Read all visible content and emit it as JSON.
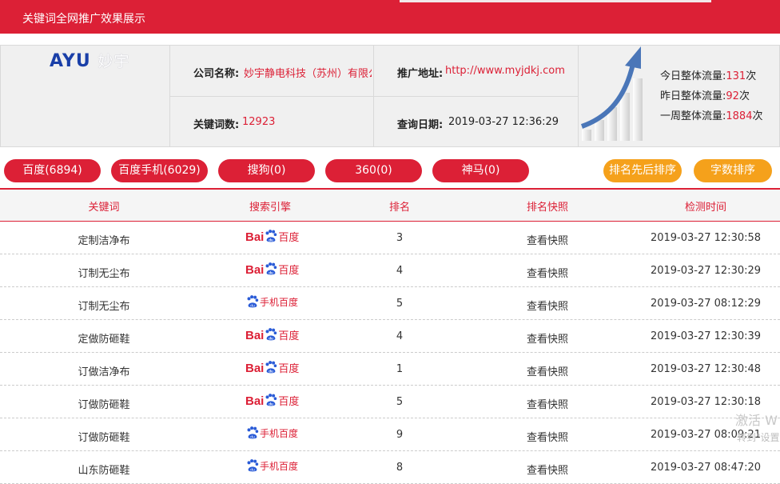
{
  "header": {
    "title": "关键词全网推广效果展示"
  },
  "logo": {
    "brand": "AYU",
    "cn": "妙宇"
  },
  "info": {
    "company_label": "公司名称:",
    "company_value": "妙宇静电科技（苏州）有限公",
    "url_label": "推广地址:",
    "url_value": "http://www.myjdkj.com",
    "keywords_label": "关键词数:",
    "keywords_value": "12923",
    "date_label": "查询日期:",
    "date_value": "2019-03-27 12:36:29"
  },
  "traffic": [
    {
      "label": "今日整体流量:",
      "num": "131",
      "unit": "次"
    },
    {
      "label": "昨日整体流量:",
      "num": "92",
      "unit": "次"
    },
    {
      "label": "一周整体流量:",
      "num": "1884",
      "unit": "次"
    }
  ],
  "tabs": [
    "百度(6894)",
    "百度手机(6029)",
    "搜狗(0)",
    "360(0)",
    "神马(0)"
  ],
  "sort_buttons": [
    "排名先后排序",
    "字数排序"
  ],
  "table": {
    "headers": [
      "关键词",
      "搜索引擎",
      "排名",
      "排名快照",
      "检测时间"
    ],
    "rows": [
      {
        "keyword": "定制洁净布",
        "engine": "baidu",
        "rank": "3",
        "snapshot": "查看快照",
        "time": "2019-03-27 12:30:58"
      },
      {
        "keyword": "订制无尘布",
        "engine": "baidu",
        "rank": "4",
        "snapshot": "查看快照",
        "time": "2019-03-27 12:30:29"
      },
      {
        "keyword": "订制无尘布",
        "engine": "baidu-mobile",
        "rank": "5",
        "snapshot": "查看快照",
        "time": "2019-03-27 08:12:29"
      },
      {
        "keyword": "定做防砸鞋",
        "engine": "baidu",
        "rank": "4",
        "snapshot": "查看快照",
        "time": "2019-03-27 12:30:39"
      },
      {
        "keyword": "订做洁净布",
        "engine": "baidu",
        "rank": "1",
        "snapshot": "查看快照",
        "time": "2019-03-27 12:30:48"
      },
      {
        "keyword": "订做防砸鞋",
        "engine": "baidu",
        "rank": "5",
        "snapshot": "查看快照",
        "time": "2019-03-27 12:30:18"
      },
      {
        "keyword": "订做防砸鞋",
        "engine": "baidu-mobile",
        "rank": "9",
        "snapshot": "查看快照",
        "time": "2019-03-27 08:09:21"
      },
      {
        "keyword": "山东防砸鞋",
        "engine": "baidu-mobile",
        "rank": "8",
        "snapshot": "查看快照",
        "time": "2019-03-27 08:47:20"
      }
    ]
  },
  "engine_labels": {
    "baidu_latin": "Bai",
    "baidu_cn": "百度",
    "baidu_mobile": "手机百度"
  },
  "watermark": {
    "line1": "激活 W",
    "line2": "转到\"设置"
  },
  "colors": {
    "brand_red": "#dc2036",
    "sort_orange": "#f5a11b",
    "logo_blue": "#1a3fa8"
  }
}
